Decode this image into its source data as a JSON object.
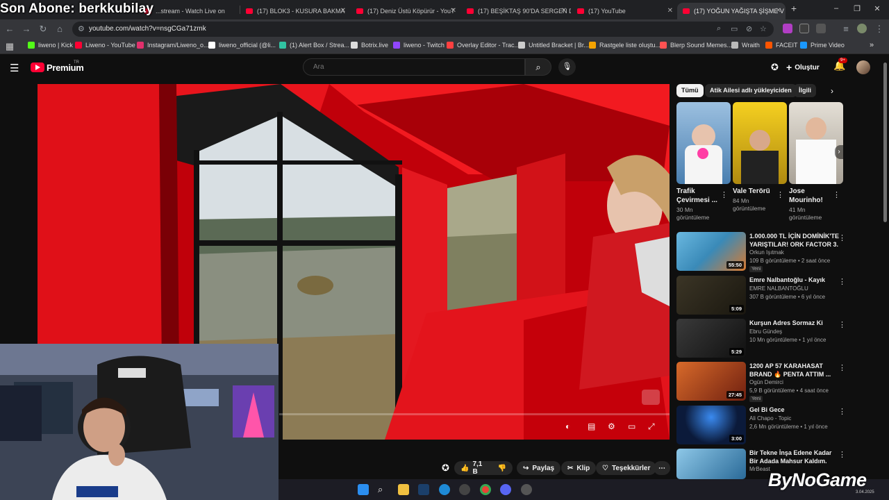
{
  "overlay": {
    "text": "Son Abone: berkkubilay"
  },
  "tabs": [
    {
      "label": "...stream - Watch Live on",
      "active": false
    },
    {
      "label": "(17) BLOK3 - KUSURA BAKMA",
      "active": false
    },
    {
      "label": "(17) Deniz Üstü Köpürür - YouT",
      "active": false
    },
    {
      "label": "(17) BEŞİKTAŞ 90'DA SERGEN D",
      "active": false
    },
    {
      "label": "(17) YouTube",
      "active": false
    },
    {
      "label": "(17) YOĞUN YAĞIŞTA ŞİŞME V",
      "active": true
    }
  ],
  "address": {
    "url": "youtube.com/watch?v=nsgCGa71zmk"
  },
  "bookmarks": [
    {
      "label": "liweno | Kick",
      "color": "#53fc18"
    },
    {
      "label": "Liweno - YouTube",
      "color": "#ff0033"
    },
    {
      "label": "Instagram/Liweno_o...",
      "color": "#e1306c"
    },
    {
      "label": "liweno_official (@li...",
      "color": "#ffffff"
    },
    {
      "label": "(1) Alert Box / Strea...",
      "color": "#31c3a2"
    },
    {
      "label": "Botrix.live",
      "color": "#dddddd"
    },
    {
      "label": "liweno - Twitch",
      "color": "#9146ff"
    },
    {
      "label": "Overlay Editor - Trac...",
      "color": "#ff4040"
    },
    {
      "label": "Untitled Bracket | Br...",
      "color": "#cccccc"
    },
    {
      "label": "Rastgele liste oluştu...",
      "color": "#f4a300"
    },
    {
      "label": "Blerp Sound Memes...",
      "color": "#ff5252"
    },
    {
      "label": "Wraith",
      "color": "#bbbbbb"
    },
    {
      "label": "FACEIT",
      "color": "#ff5500"
    },
    {
      "label": "Prime Video",
      "color": "#1a98ff"
    }
  ],
  "header": {
    "logo": "Premium",
    "logo_region": "TR",
    "search_placeholder": "Ara",
    "create_label": "Oluştur",
    "notif_count": "9+"
  },
  "actions": {
    "likes": "7,1 B",
    "share": "Paylaş",
    "clip": "Klip",
    "thanks": "Teşekkürler"
  },
  "chips": [
    {
      "label": "Tümü",
      "selected": true
    },
    {
      "label": "Atik Ailesi adlı yükleyiciden",
      "selected": false
    },
    {
      "label": "İlgili",
      "selected": false
    }
  ],
  "shorts": [
    {
      "title": "Trafik Çevirmesi ...",
      "views": "30 Mn görüntüleme",
      "thumb": "#4a7fb0"
    },
    {
      "title": "Vale Terörü",
      "views": "84 Mn görüntüleme",
      "thumb": "#d9b01c"
    },
    {
      "title": "Jose Mourinho!",
      "views": "41 Mn görüntüleme",
      "thumb": "#c9c3b8"
    }
  ],
  "recommendations": [
    {
      "title": "1.000.000 TL İÇİN DOMİNİK'TE YARIŞTILAR! ORK FACTOR 3. ...",
      "channel": "Orkun Işıtmak",
      "meta": "109 B görüntüleme • 2 saat önce",
      "badge": "Yeni",
      "duration": "55:50",
      "thumb": "#3a8ab8"
    },
    {
      "title": "Emre Nalbantoğlu - Kayık",
      "channel": "EMRE NALBANTOĞLU",
      "meta": "307 B görüntüleme • 6 yıl önce",
      "badge": "",
      "duration": "5:09",
      "thumb": "#2b2618"
    },
    {
      "title": "Kurşun Adres Sormaz Ki",
      "channel": "Ebru Gündeş",
      "meta": "10 Mn görüntüleme • 1 yıl önce",
      "badge": "",
      "duration": "5:29",
      "thumb": "#1e1e1e"
    },
    {
      "title": "1200 AP 57 KARAHASAT BRAND 🔥 PENTA ATTIM ...",
      "channel": "Ogün Demirci",
      "meta": "5,9 B görüntüleme • 4 saat önce",
      "badge": "Yeni",
      "duration": "27:45",
      "thumb": "#b04a22"
    },
    {
      "title": "Gel Bi Gece",
      "channel": "Ali Chapo - Topic",
      "meta": "2,6 Mn görüntüleme • 1 yıl önce",
      "badge": "",
      "duration": "3:00",
      "thumb": "#0b1a3a"
    },
    {
      "title": "Bir Tekne İnşa Edene Kadar Bir Adada Mahsur Kaldım.",
      "channel": "MrBeast",
      "meta": "",
      "badge": "",
      "duration": "",
      "thumb": "#4a8fb8"
    }
  ],
  "watermark": {
    "brand": "ByNoGame",
    "date": "3.04.2025"
  }
}
